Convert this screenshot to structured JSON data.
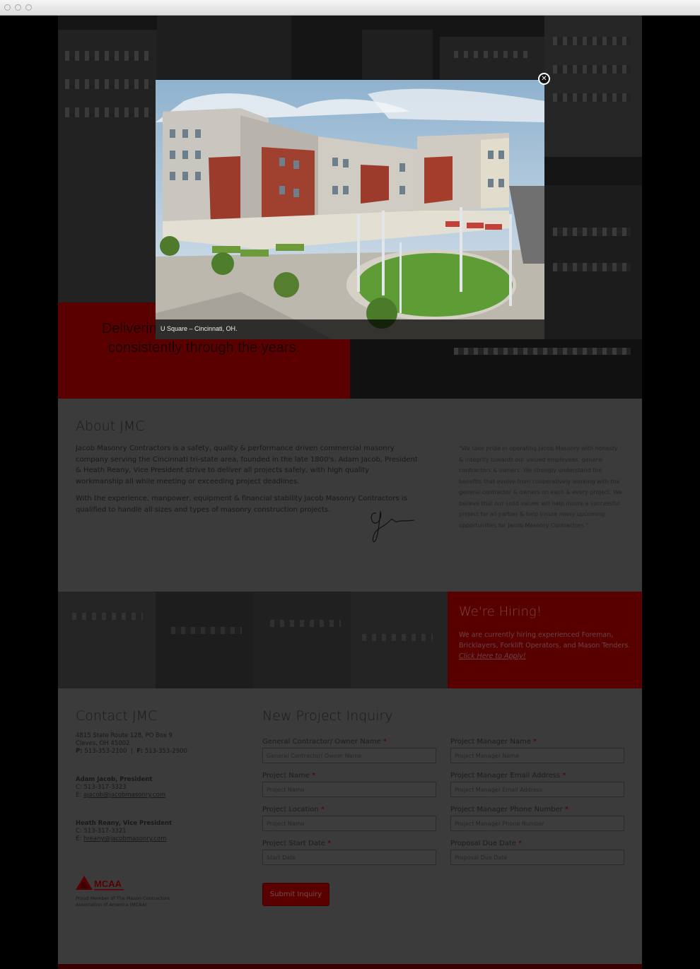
{
  "hero": {
    "tagline": "Delivering a project performance consistently through the years."
  },
  "lightbox": {
    "caption": "U Square – Cincinnati, OH.",
    "close_icon": "close-icon"
  },
  "about": {
    "title": "About JMC",
    "paragraph1": "Jacob Masonry Contractors is a safety, quality & performance driven commercial masonry company serving the Cincinnati tri-state area, founded in the late 1800's. Adam Jacob, President & Heath Reany, Vice President strive to deliver all projects safely, with high quality workmanship all while meeting or exceeding project deadlines.",
    "paragraph2": "With the experience, manpower, equipment & financial stability Jacob Masonry Contractors is qualified to handle all sizes and types of masonry construction projects.",
    "quote": "\"We take pride in operating Jacob Masonry with honesty & integrity towards our valued employees, general contractors & owners. We strongly understand the benefits that evolve from cooperatively working with the general contractor & owners on each & every project. We believe that our solid values will help insure a successful project for all parties & help insure many upcoming opportunities for Jacob Masonry Contractors.\""
  },
  "hiring": {
    "title": "We're Hiring!",
    "text": "We are currently hiring experienced Foreman, Bricklayers, Forklift Operators, and Mason Tenders.",
    "link": "Click Here to Apply!"
  },
  "contact": {
    "title": "Contact JMC",
    "address1": "4815 State Route 128, PO Box 9",
    "address2": "Cleves, OH 45002",
    "phone_label": "P:",
    "phone": "513-353-2100",
    "fax_sep": "|",
    "fax_label": "F:",
    "fax": "513-353-2900",
    "person1_name": "Adam Jacob, President",
    "person1_cell": "C: 513-317-3323",
    "person1_email_label": "E:",
    "person1_email": "ajacob@jacobmasonry.com",
    "person2_name": "Heath Reany, Vice President",
    "person2_cell": "C: 513-317-3321",
    "person2_email_label": "E:",
    "person2_email": "hreany@jacobmasonry.com",
    "mcaa_logo_text": "MCAA",
    "mcaa_caption": "Proud Member of The Mason Contractors Association of America (MCAA)"
  },
  "form": {
    "title": "New Project Inquiry",
    "required_mark": "*",
    "fields": [
      {
        "label": "General Contractor/ Owner Name",
        "placeholder": "General Contractor/ Owner Name"
      },
      {
        "label": "Project Manager Name",
        "placeholder": "Project Manager Name"
      },
      {
        "label": "Project Name",
        "placeholder": "Project Name"
      },
      {
        "label": "Project Manager Email Address",
        "placeholder": "Project Manager Email Address"
      },
      {
        "label": "Project Location",
        "placeholder": "Project Name"
      },
      {
        "label": "Project Manager Phone Number",
        "placeholder": "Project Manager Phone Number"
      },
      {
        "label": "Project Start Date",
        "placeholder": "Start Date"
      },
      {
        "label": "Proposal Due Date",
        "placeholder": "Proposal Due Date"
      }
    ],
    "submit": "Submit Inquiry"
  },
  "colors": {
    "accent_red": "#8b0000",
    "overlay": "#000000"
  }
}
